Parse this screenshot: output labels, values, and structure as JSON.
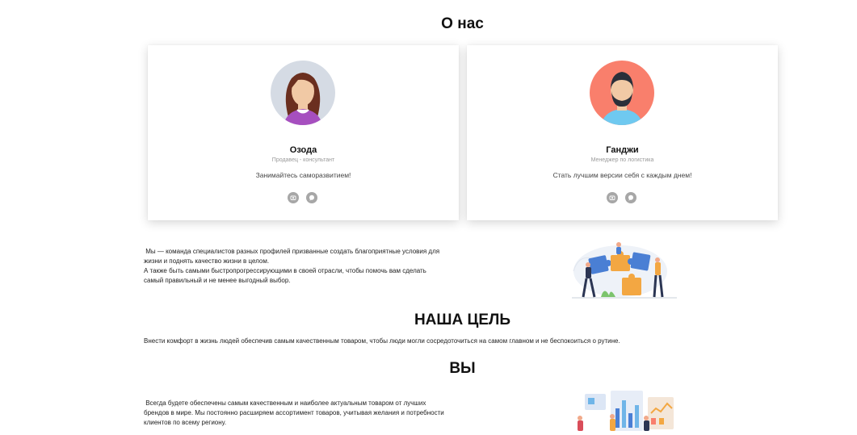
{
  "about": {
    "title": "О нас",
    "members": [
      {
        "name": "Озода",
        "role": "Продавец - консультант",
        "motto": "Занимайтесь саморазвитием!",
        "social_icons": [
          "camera-icon",
          "chat-icon"
        ]
      },
      {
        "name": "Ганджи",
        "role": "Менеджер по логистика",
        "motto": "Стать лучшим версии себя с каждым днем!",
        "social_icons": [
          "camera-icon",
          "chat-icon"
        ]
      }
    ],
    "paragraph_lines": [
      " Мы — команда специалистов разных профилей призванные создать благоприятные условия для",
      "жизни и поднять качество жизни в целом.",
      "А также быть самыми быстропрогрессирующими в своей отрасли, чтобы помочь вам сделать",
      "самый правильный и не менее выгодный выбор."
    ]
  },
  "goal": {
    "title": "НАША ЦЕЛЬ",
    "text": "Внести комфорт в жизнь людей обеспечив самым качественным товаром, чтобы люди могли сосредоточиться на самом главном и не беспокоиться о рутине."
  },
  "you": {
    "title": "ВЫ",
    "paragraph_lines": [
      " Всегда будете обеспечены самым качественным и наиболее актуальным товаром от лучших",
      "брендов в мире. Мы постоянно расширяем ассортимент товаров, учитывая желания и потребности",
      "клиентов по всему региону."
    ]
  },
  "colors": {
    "avatar1_bg": "#d5dbe4",
    "avatar2_bg": "#f97f6c",
    "social_icon_bg": "#a7a7a7",
    "puzzle_blue": "#4a7fd4",
    "puzzle_orange": "#f3a742"
  }
}
